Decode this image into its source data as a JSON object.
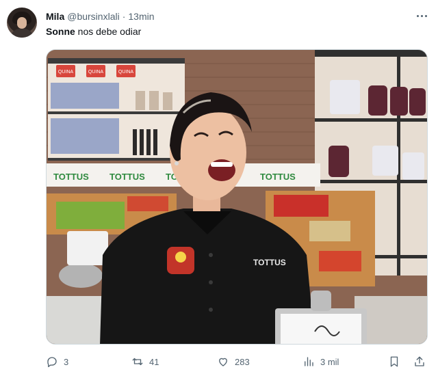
{
  "tweet": {
    "author_name": "Mila",
    "author_handle": "@bursinxlali",
    "separator": "·",
    "time": "13min",
    "text_bold": "Sonne",
    "text_rest": " nos debe odiar"
  },
  "media": {
    "store_signs": [
      "TOTTUS",
      "TOTTUS",
      "TOTTUS",
      "TOTTUS"
    ],
    "shelf_labels": [
      "QUINA",
      "QUINA",
      "QUINA"
    ],
    "jacket_logo_text": "TOTTUS"
  },
  "actions": {
    "replies": "3",
    "retweets": "41",
    "likes": "283",
    "views": "3 mil"
  },
  "icons": {
    "more": "more-icon",
    "reply": "reply-icon",
    "retweet": "retweet-icon",
    "like": "heart-icon",
    "views": "views-icon",
    "bookmark": "bookmark-icon",
    "share": "share-icon"
  },
  "colors": {
    "text": "#0f1419",
    "secondary": "#536471",
    "border": "#cfd9de",
    "sign_green": "#2f8a3f"
  }
}
